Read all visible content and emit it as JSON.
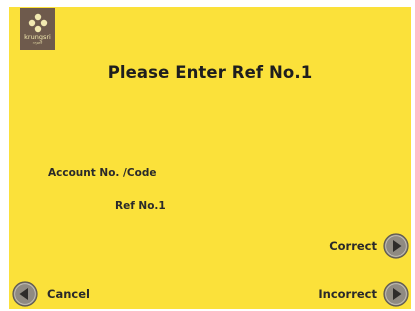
{
  "brand": {
    "name": "krungsri",
    "sub": "กรุงศรี"
  },
  "screen": {
    "title": "Please Enter Ref No.1",
    "account_label": "Account No. /Code",
    "ref_label": "Ref No.1"
  },
  "buttons": {
    "correct": "Correct",
    "incorrect": "Incorrect",
    "cancel": "Cancel"
  },
  "colors": {
    "background": "#fbe13a",
    "logo_bg": "#6e5a4c",
    "arrow_fill": "#8f8a82"
  },
  "icons": {
    "logo": "krungsri-logo-icon",
    "next": "arrow-right-icon",
    "back": "arrow-left-icon"
  }
}
